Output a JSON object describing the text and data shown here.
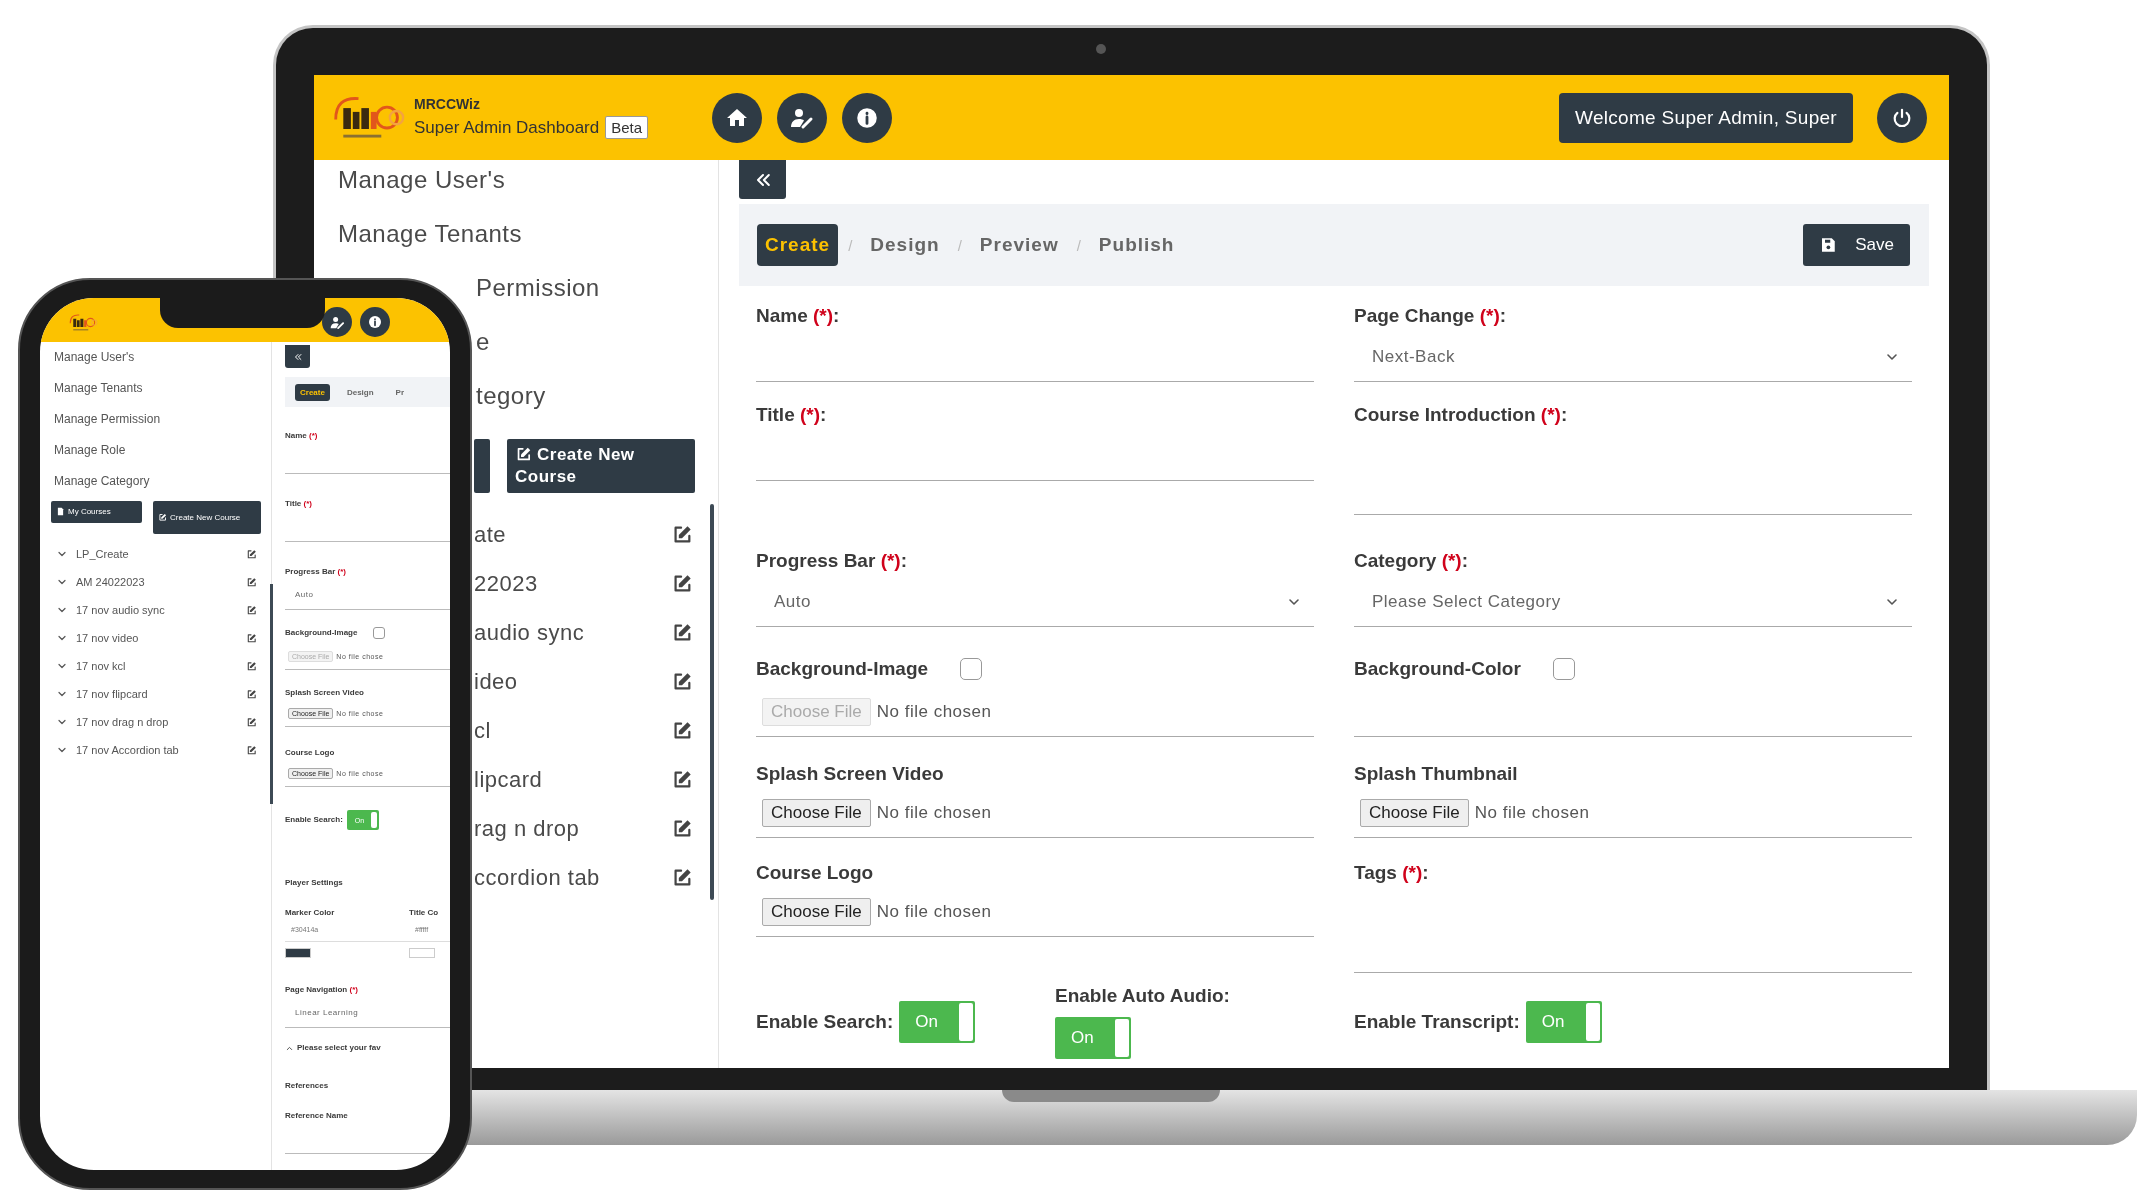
{
  "laptop": {
    "header": {
      "brand": "MRCCWiz",
      "subtitle": "Super Admin Dashboard",
      "badge": "Beta",
      "welcome": "Welcome Super Admin, Super"
    },
    "sidebar": {
      "menu": [
        "Manage User's",
        "Manage Tenants"
      ],
      "menu_partly_hidden": [
        "Permission",
        "e",
        "tegory"
      ],
      "create_button": "Create New Course",
      "courses_partly_hidden": [
        "ate",
        "22023",
        "audio sync",
        "ideo",
        "cl",
        "lipcard",
        "rag n drop",
        "ccordion tab"
      ]
    },
    "tabs": [
      {
        "label": "Create",
        "selected": true
      },
      {
        "label": "Design",
        "selected": false
      },
      {
        "label": "Preview",
        "selected": false
      },
      {
        "label": "Publish",
        "selected": false
      }
    ],
    "tab_separator": "/",
    "save_button": "Save",
    "form": {
      "rows": [
        [
          {
            "kind": "text",
            "label": "Name",
            "mark": "(*)",
            "end": ":"
          },
          {
            "kind": "select",
            "label": "Page Change",
            "mark": "(*)",
            "end": ":",
            "value": "Next-Back"
          }
        ],
        [
          {
            "kind": "text",
            "label": "Title",
            "mark": "(*)",
            "end": ":"
          },
          {
            "kind": "textarea",
            "label": "Course Introduction",
            "mark": "(*)",
            "end": ":"
          }
        ],
        [
          {
            "kind": "select",
            "label": "Progress Bar",
            "mark": "(*)",
            "end": ":",
            "value": "Auto"
          },
          {
            "kind": "select",
            "label": "Category",
            "mark": "(*)",
            "end": ":",
            "value": "Please Select Category"
          }
        ],
        [
          {
            "kind": "checkbox-file",
            "label": "Background-Image",
            "checked": false,
            "file": {
              "button": "Choose File",
              "status": "No file chosen",
              "disabled": true
            }
          },
          {
            "kind": "checkbox",
            "label": "Background-Color",
            "checked": false
          }
        ],
        [
          {
            "kind": "file",
            "label": "Splash Screen Video",
            "file": {
              "button": "Choose File",
              "status": "No file chosen",
              "disabled": false
            }
          },
          {
            "kind": "file",
            "label": "Splash Thumbnail",
            "file": {
              "button": "Choose File",
              "status": "No file chosen",
              "disabled": false
            }
          }
        ],
        [
          {
            "kind": "file",
            "label": "Course Logo",
            "file": {
              "button": "Choose File",
              "status": "No file chosen",
              "disabled": false
            }
          },
          {
            "kind": "textarea",
            "label": "Tags",
            "mark": "(*)",
            "end": ":"
          }
        ]
      ],
      "switches": [
        {
          "kind": "inline",
          "label": "Enable Search:",
          "on": true,
          "text": "On"
        },
        {
          "kind": "stacked",
          "label": "Enable Auto Audio:",
          "on": true,
          "text": "On"
        },
        {
          "kind": "inline",
          "label": "Enable Transcript:",
          "on": true,
          "text": "On"
        }
      ]
    }
  },
  "phone": {
    "sidebar": {
      "menu": [
        "Manage User's",
        "Manage Tenants",
        "Manage Permission",
        "Manage Role",
        "Manage Category"
      ],
      "buttons": [
        "My Courses",
        "Create New Course"
      ],
      "courses": [
        "LP_Create",
        "AM 24022023",
        "17 nov audio sync",
        "17 nov video",
        "17 nov kcl",
        "17 nov flipcard",
        "17 nov drag n drop",
        "17 nov Accordion tab"
      ]
    },
    "tabs": [
      {
        "label": "Create",
        "selected": true
      },
      {
        "label": "Design",
        "selected": false
      },
      {
        "label": "Pr",
        "selected": false
      }
    ],
    "form": [
      {
        "kind": "text",
        "label": "Name",
        "mark": "(*)"
      },
      {
        "kind": "text",
        "label": "Title",
        "mark": "(*)"
      },
      {
        "kind": "select",
        "label": "Progress Bar",
        "mark": "(*)",
        "value": "Auto"
      },
      {
        "kind": "checkbox-file",
        "label": "Background-Image",
        "checked": false,
        "file": {
          "button": "Choose File",
          "status": "No file chose",
          "disabled": true
        }
      },
      {
        "kind": "file",
        "label": "Splash Screen Video",
        "file": {
          "button": "Choose File",
          "status": "No file chose",
          "disabled": false
        }
      },
      {
        "kind": "file",
        "label": "Course Logo",
        "file": {
          "button": "Choose File",
          "status": "No file chose",
          "disabled": false
        }
      },
      {
        "kind": "toggle",
        "label": "Enable Search:",
        "on": true,
        "text": "On"
      },
      {
        "kind": "heading",
        "label": "Player Settings"
      },
      {
        "kind": "colors",
        "items": [
          {
            "label": "Marker Color",
            "value": "#30414a",
            "color": "#2f3b45"
          },
          {
            "label": "Title Co",
            "value": "#fffff",
            "color": "#ffffff"
          }
        ]
      },
      {
        "kind": "select",
        "label": "Page Navigation",
        "mark": "(*)",
        "value": "Linear Learning"
      },
      {
        "kind": "collapse",
        "label": "Please select your fav"
      },
      {
        "kind": "heading",
        "label": "References"
      },
      {
        "kind": "text",
        "label": "Reference Name"
      }
    ]
  }
}
